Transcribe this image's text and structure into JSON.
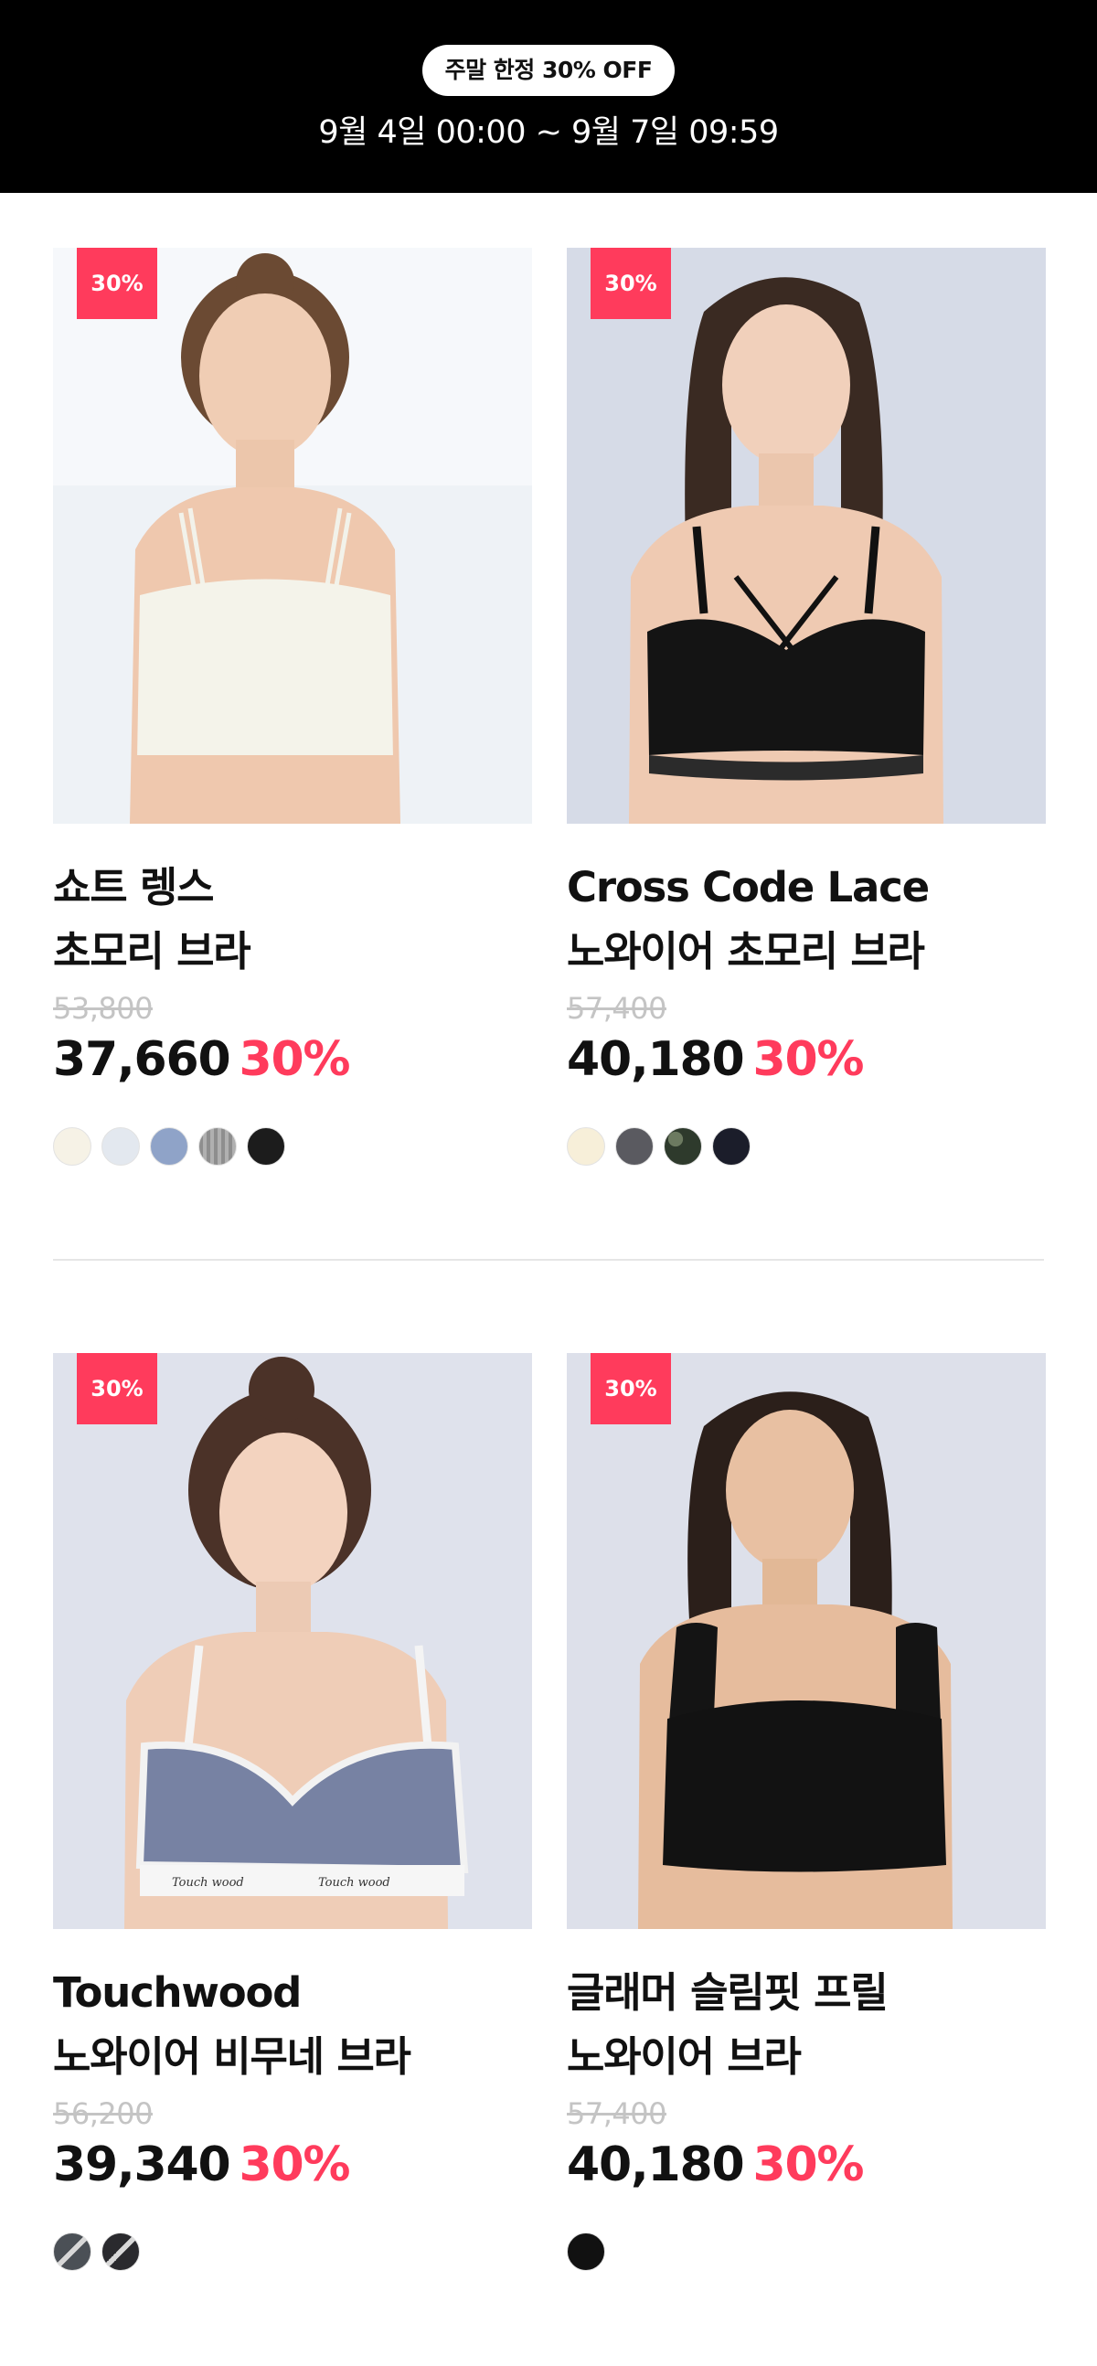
{
  "banner": {
    "pill": "주말 한정 30% OFF",
    "period": "9월 4일 00:00 ~ 9월 7일 09:59"
  },
  "products": [
    {
      "badge": "30%",
      "name_line1": "쇼트 렝스",
      "name_line2": "초모리 브라",
      "original_price": "53,800",
      "sale_price": "37,660",
      "discount": "30%",
      "swatches": [
        "#f6f2e6",
        "#e3e8ef",
        "#8fa3c8",
        "#9a9a9a",
        "#1c1c1c"
      ],
      "image": "model-white-cami-bra"
    },
    {
      "badge": "30%",
      "name_line1": "Cross Code Lace",
      "name_line2": "노와이어 초모리 브라",
      "original_price": "57,400",
      "sale_price": "40,180",
      "discount": "30%",
      "swatches": [
        "#f7efd9",
        "#5a5a60",
        "#2e3a2c",
        "#1b1d2a"
      ],
      "image": "model-black-lace-bra"
    },
    {
      "badge": "30%",
      "name_line1": "Touchwood",
      "name_line2": "노와이어 비무네 브라",
      "original_price": "56,200",
      "sale_price": "39,340",
      "discount": "30%",
      "swatches": [
        "#4b5056",
        "#2a2a2e"
      ],
      "image": "model-blue-gray-bra"
    },
    {
      "badge": "30%",
      "name_line1": "글래머 슬림핏 프릴",
      "name_line2": "노와이어 브라",
      "original_price": "57,400",
      "sale_price": "40,180",
      "discount": "30%",
      "swatches": [
        "#111111"
      ],
      "image": "model-black-frill-bra"
    }
  ],
  "colors": {
    "accent": "#ff3b5c",
    "banner_bg": "#000000"
  }
}
